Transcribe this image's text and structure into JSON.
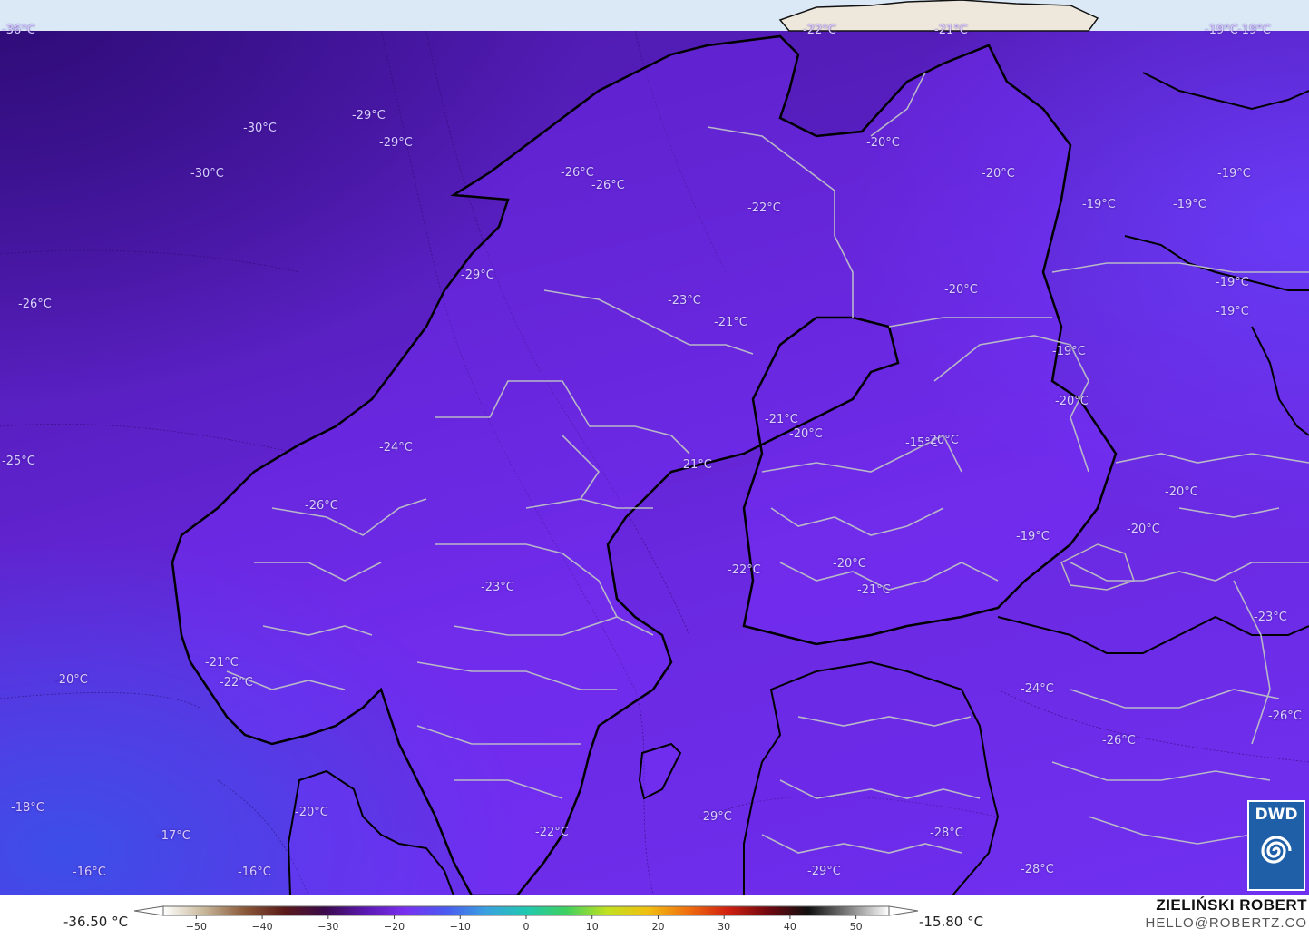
{
  "map": {
    "temperature_labels": [
      {
        "text": "-36°C"
      },
      {
        "text": "-22°C"
      },
      {
        "text": "-21°C"
      },
      {
        "text": "-19°C"
      },
      {
        "text": "-19°C"
      },
      {
        "text": "-30°C"
      },
      {
        "text": "-29°C"
      },
      {
        "text": "-29°C"
      },
      {
        "text": "-30°C"
      },
      {
        "text": "-20°C"
      },
      {
        "text": "-26°C"
      },
      {
        "text": "-26°C"
      },
      {
        "text": "-20°C"
      },
      {
        "text": "-19°C"
      },
      {
        "text": "-22°C"
      },
      {
        "text": "-19°C"
      },
      {
        "text": "-19°C"
      },
      {
        "text": "-29°C"
      },
      {
        "text": "-26°C"
      },
      {
        "text": "-23°C"
      },
      {
        "text": "-20°C"
      },
      {
        "text": "-19°C"
      },
      {
        "text": "-21°C"
      },
      {
        "text": "-19°C"
      },
      {
        "text": "-19°C"
      },
      {
        "text": "-20°C"
      },
      {
        "text": "-21°C"
      },
      {
        "text": "-20°C"
      },
      {
        "text": "-25°C"
      },
      {
        "text": "-24°C"
      },
      {
        "text": "-15°C"
      },
      {
        "text": "-20°C"
      },
      {
        "text": "-21°C"
      },
      {
        "text": "-20°C"
      },
      {
        "text": "-26°C"
      },
      {
        "text": "-20°C"
      },
      {
        "text": "-19°C"
      },
      {
        "text": "-23°C"
      },
      {
        "text": "-22°C"
      },
      {
        "text": "-20°C"
      },
      {
        "text": "-21°C"
      },
      {
        "text": "-23°C"
      },
      {
        "text": "-20°C"
      },
      {
        "text": "-21°C"
      },
      {
        "text": "-22°C"
      },
      {
        "text": "-24°C"
      },
      {
        "text": "-26°C"
      },
      {
        "text": "-26°C"
      },
      {
        "text": "-18°C"
      },
      {
        "text": "-20°C"
      },
      {
        "text": "-29°C"
      },
      {
        "text": "-17°C"
      },
      {
        "text": "-22°C"
      },
      {
        "text": "-28°C"
      },
      {
        "text": "-16°C"
      },
      {
        "text": "-16°C"
      },
      {
        "text": "-29°C"
      },
      {
        "text": "-28°C"
      }
    ]
  },
  "legend": {
    "min_label": "-36.50 °C",
    "max_label": "-15.80 °C",
    "ticks": [
      "−50",
      "−40",
      "−30",
      "−20",
      "−10",
      "0",
      "10",
      "20",
      "30",
      "40",
      "50"
    ],
    "colorbar_stops": [
      "#ffffff",
      "#c8b89a",
      "#8a5a3a",
      "#5a1a1a",
      "#3a0a4a",
      "#5a18b0",
      "#7a30f0",
      "#4a5af0",
      "#3aa0e0",
      "#20c8b0",
      "#40d060",
      "#c0e020",
      "#f0c010",
      "#f07010",
      "#d02010",
      "#700810",
      "#101010",
      "#808080",
      "#ffffff"
    ]
  },
  "author": {
    "name": "ZIELIŃSKI ROBERT",
    "email": "HELLO@ROBERTZ.CO"
  },
  "logo": {
    "text": "DWD",
    "color": "#1e5fa8"
  }
}
